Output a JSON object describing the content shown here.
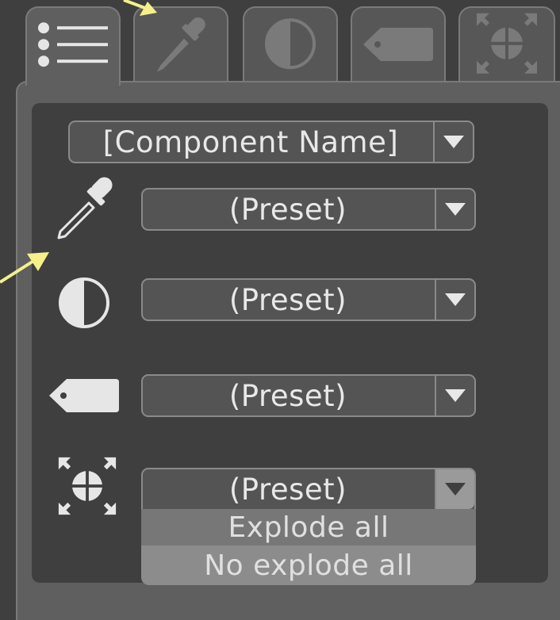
{
  "tabs": [
    {
      "icon": "list-icon",
      "active": true
    },
    {
      "icon": "eyedropper-icon",
      "active": false
    },
    {
      "icon": "contrast-icon",
      "active": false
    },
    {
      "icon": "tag-icon",
      "active": false
    },
    {
      "icon": "explode-icon",
      "active": false
    }
  ],
  "component": {
    "label": "[Component Name]"
  },
  "rows": [
    {
      "icon": "eyedropper-icon",
      "preset": "(Preset)"
    },
    {
      "icon": "contrast-icon",
      "preset": "(Preset)"
    },
    {
      "icon": "tag-icon",
      "preset": "(Preset)"
    },
    {
      "icon": "explode-icon",
      "preset": "(Preset)"
    }
  ],
  "menu": {
    "items": [
      "Explode all",
      "No explode all"
    ],
    "hovered": 1
  },
  "colors": {
    "background": "#3f3f3f",
    "panel": "#5f5f5f",
    "annotation_arrow": "#f5f08a"
  }
}
